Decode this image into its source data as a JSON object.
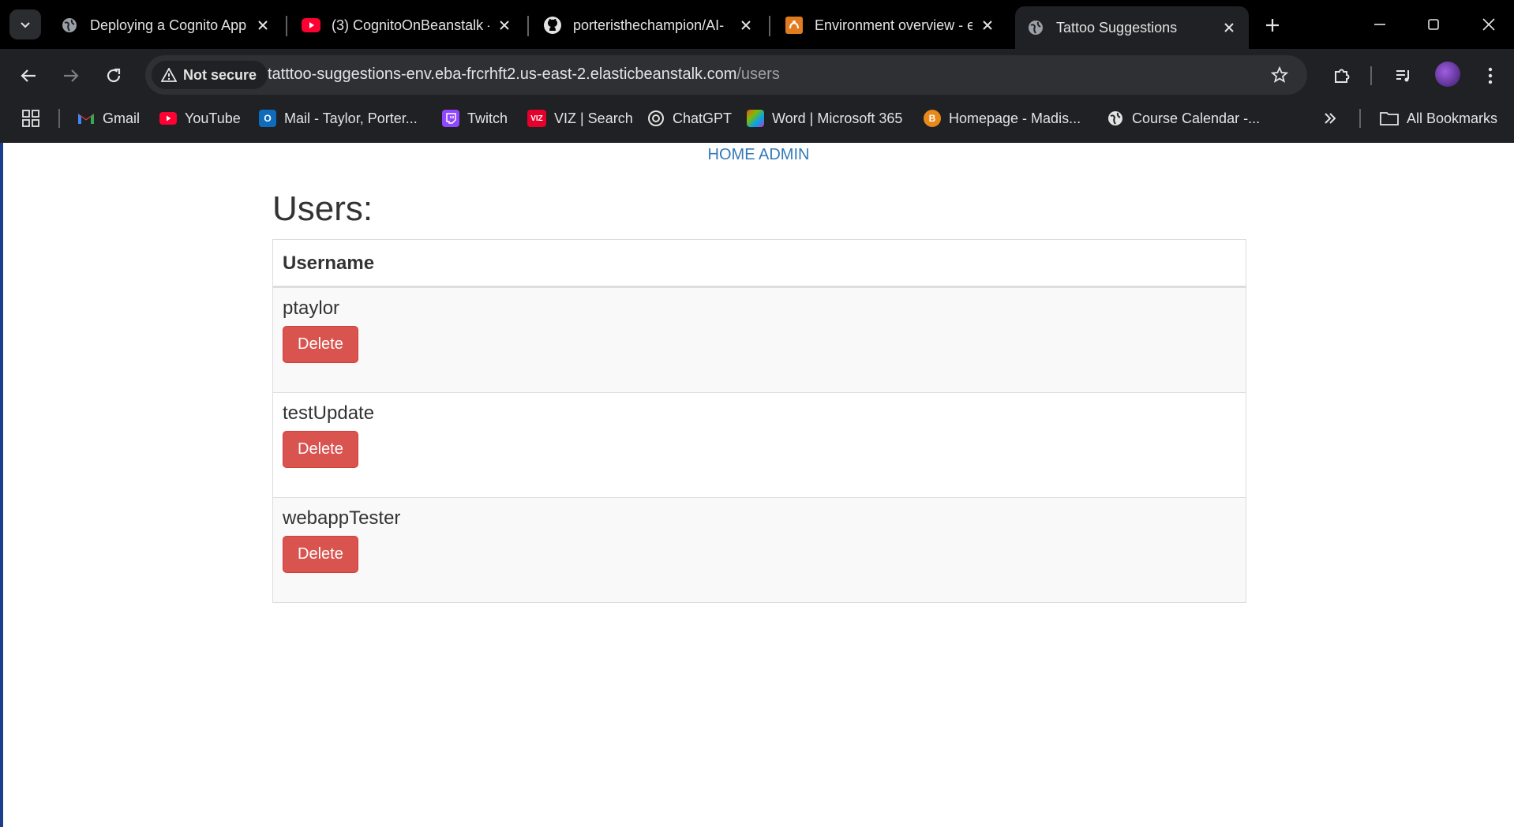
{
  "browser": {
    "tabs": [
      {
        "title": "Deploying a Cognito App",
        "icon": "globe-icon"
      },
      {
        "title": "(3) CognitoOnBeanstalk -",
        "icon": "youtube-icon"
      },
      {
        "title": "porteristhechampion/AI-",
        "icon": "github-icon"
      },
      {
        "title": "Environment overview - e",
        "icon": "aws-beanstalk-icon"
      },
      {
        "title": "Tattoo Suggestions",
        "icon": "globe-icon",
        "active": true
      }
    ],
    "security_label": "Not secure",
    "url_host": "tatttoo-suggestions-env.eba-frcrhft2.us-east-2.elasticbeanstalk.com",
    "url_path": "/users",
    "bookmarks": [
      {
        "label": "Gmail",
        "icon": "gmail-icon"
      },
      {
        "label": "YouTube",
        "icon": "youtube-icon"
      },
      {
        "label": "Mail - Taylor, Porter...",
        "icon": "outlook-icon"
      },
      {
        "label": "Twitch",
        "icon": "twitch-icon"
      },
      {
        "label": "VIZ | Search",
        "icon": "viz-icon"
      },
      {
        "label": "ChatGPT",
        "icon": "chatgpt-icon"
      },
      {
        "label": "Word | Microsoft 365",
        "icon": "microsoft365-icon"
      },
      {
        "label": "Homepage - Madis...",
        "icon": "homepage-icon"
      },
      {
        "label": "Course Calendar -...",
        "icon": "globe-icon"
      }
    ],
    "all_bookmarks_label": "All Bookmarks",
    "colors": {
      "chrome_bg": "#202124",
      "tabstrip_bg": "#000000",
      "link": "#337ab7",
      "danger": "#d9534f"
    }
  },
  "page": {
    "nav": {
      "home": "HOME",
      "admin": "ADMIN"
    },
    "title": "Users:",
    "table": {
      "header": "Username",
      "rows": [
        {
          "username": "ptaylor",
          "action": "Delete"
        },
        {
          "username": "testUpdate",
          "action": "Delete"
        },
        {
          "username": "webappTester",
          "action": "Delete"
        }
      ]
    }
  }
}
